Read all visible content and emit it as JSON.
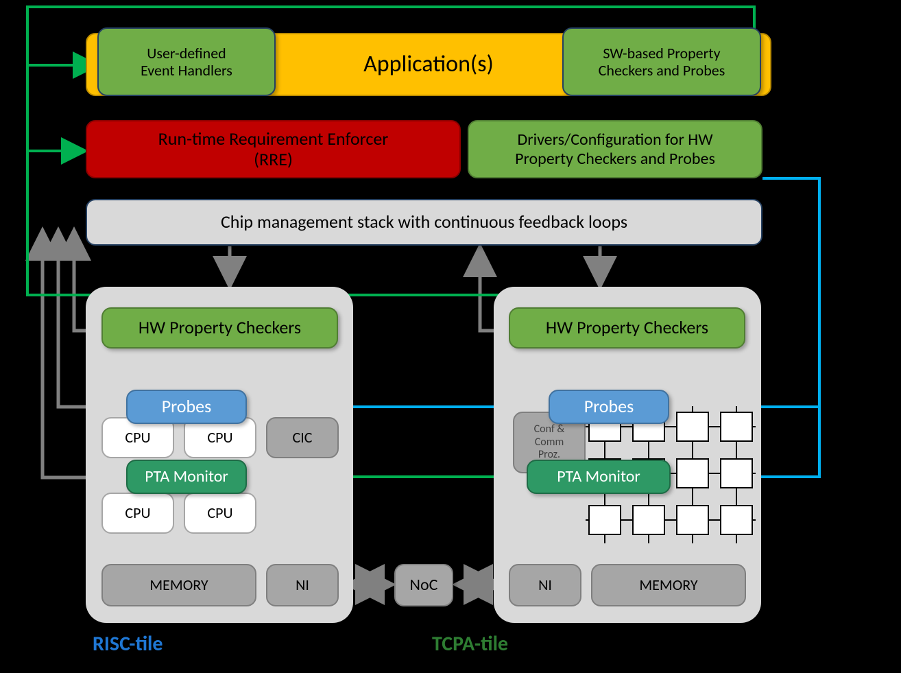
{
  "colors": {
    "limegreen": "#70AD47",
    "limegreenBorder": "#507E33",
    "red": "#C00000",
    "redBorder": "#8A0000",
    "amber": "#FFC000",
    "amberBorder": "#BC8C00",
    "grey": "#D9D9D9",
    "greyBorder": "#254061",
    "blue": "#5B9BD5",
    "blueBorder": "#41729F",
    "teal": "#2E9965",
    "tealBorder": "#1F6B46",
    "midgrey": "#A6A6A6",
    "midgreyBorder": "#7F7F7F",
    "lightgrey": "#D9D9D9",
    "white": "#FFFFFF",
    "black": "#000000",
    "blueText": "#1F77D4",
    "greenText": "#2E7D32",
    "arrowGrey": "#808080",
    "arrowGreen": "#00B050",
    "arrowBlue": "#00B0F0"
  },
  "row1": {
    "applications": "Application(s)",
    "userHandlers": "User-defined\nEvent Handlers",
    "swCheckers": "SW-based Property\nCheckers and Probes"
  },
  "row2": {
    "rre": "Run-time Requirement Enforcer\n(RRE)",
    "drivers": "Drivers/Configuration for HW\nProperty Checkers and Probes"
  },
  "row3": {
    "chipStack": "Chip management stack with continuous feedback loops"
  },
  "tiles": {
    "leftLabel": "RISC-tile",
    "rightLabel": "TCPA-tile",
    "hwCheckers": "HW Property Checkers",
    "probes": "Probes",
    "pta": "PTA Monitor",
    "cpu": "CPU",
    "cic": "CIC",
    "memory": "MEMORY",
    "ni": "NI",
    "noc": "NoC",
    "confComm": "Conf &\nComm\nProz."
  }
}
